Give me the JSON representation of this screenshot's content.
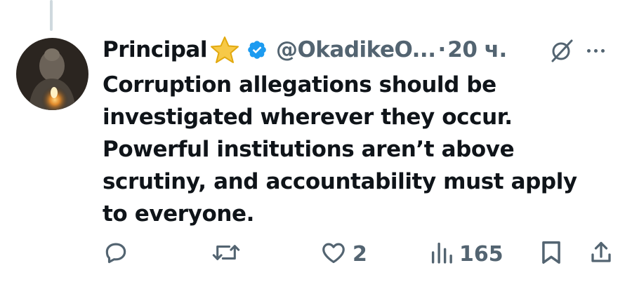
{
  "tweet": {
    "author_name": "Principal",
    "handle": "@OkadikeO...",
    "separator": "·",
    "time": "20 ч.",
    "text_lines": [
      "Corruption allegations should be",
      "investigated wherever they occur.",
      "Powerful institutions aren’t above",
      "scrutiny, and accountability must apply",
      "to everyone."
    ]
  },
  "actions": {
    "likes": "2",
    "views": "165"
  },
  "icons": {
    "star": "star-emoji-icon",
    "verified": "verified-badge-icon",
    "grok": "grok-icon",
    "more": "more-icon",
    "reply": "reply-icon",
    "retweet": "retweet-icon",
    "like": "like-icon",
    "views": "views-icon",
    "bookmark": "bookmark-icon",
    "share": "share-icon"
  },
  "colors": {
    "text": "#0f1419",
    "muted": "#536471",
    "verified": "#1d9bf0",
    "star": "#f7c948"
  }
}
